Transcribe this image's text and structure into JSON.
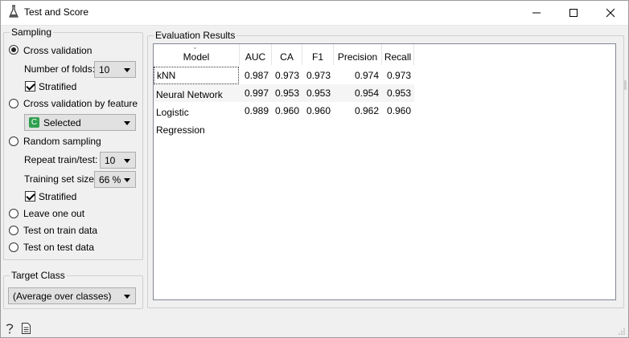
{
  "window": {
    "title": "Test and Score"
  },
  "sampling": {
    "title": "Sampling",
    "cross_validation": "Cross validation",
    "folds_label": "Number of folds:",
    "folds_value": "10",
    "stratified_1": "Stratified",
    "cv_by_feature": "Cross validation by feature",
    "feature_badge": "C",
    "feature_value": "Selected",
    "random_sampling": "Random sampling",
    "repeat_label": "Repeat train/test:",
    "repeat_value": "10",
    "train_size_label": "Training set size:",
    "train_size_value": "66 %",
    "stratified_2": "Stratified",
    "leave_one_out": "Leave one out",
    "test_on_train": "Test on train data",
    "test_on_test": "Test on test data"
  },
  "target": {
    "title": "Target Class",
    "value": "(Average over classes)"
  },
  "results": {
    "title": "Evaluation Results",
    "columns": [
      "Model",
      "AUC",
      "CA",
      "F1",
      "Precision",
      "Recall"
    ],
    "rows": [
      [
        "kNN",
        "0.987",
        "0.973",
        "0.973",
        "0.974",
        "0.973"
      ],
      [
        "Neural Network",
        "0.997",
        "0.953",
        "0.953",
        "0.954",
        "0.953"
      ],
      [
        "Logistic Regression",
        "0.989",
        "0.960",
        "0.960",
        "0.962",
        "0.960"
      ]
    ]
  },
  "colors": {
    "accent_green": "#2ea04f",
    "row_alt": "#f5f5f5"
  },
  "icons": [
    "help-icon",
    "report-icon",
    "minimize-icon",
    "maximize-icon",
    "close-icon",
    "app-icon",
    "resize-grip-icon"
  ]
}
